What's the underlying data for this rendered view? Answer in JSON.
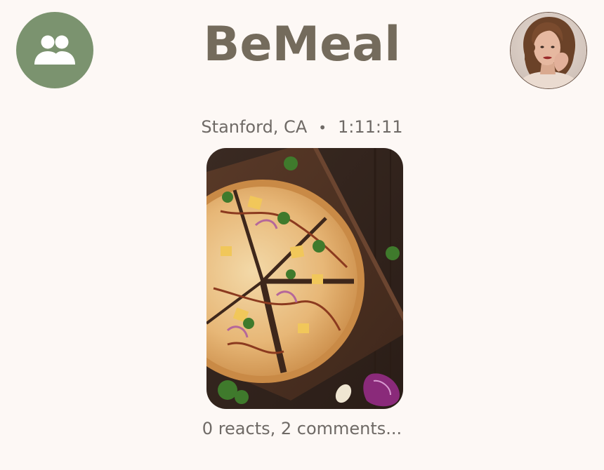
{
  "header": {
    "title": "BeMeal",
    "friends_icon": "people-group-icon",
    "profile_icon": "profile-avatar"
  },
  "post": {
    "location": "Stanford, CA",
    "separator": "•",
    "time": "1:11:11",
    "photo_icon": "pizza-photo",
    "reactions_text": "0 reacts, 2 comments..."
  },
  "colors": {
    "background": "#fdf8f5",
    "accent_green": "#7b936f",
    "title": "#746b5c",
    "muted_text": "#6f6a66"
  }
}
